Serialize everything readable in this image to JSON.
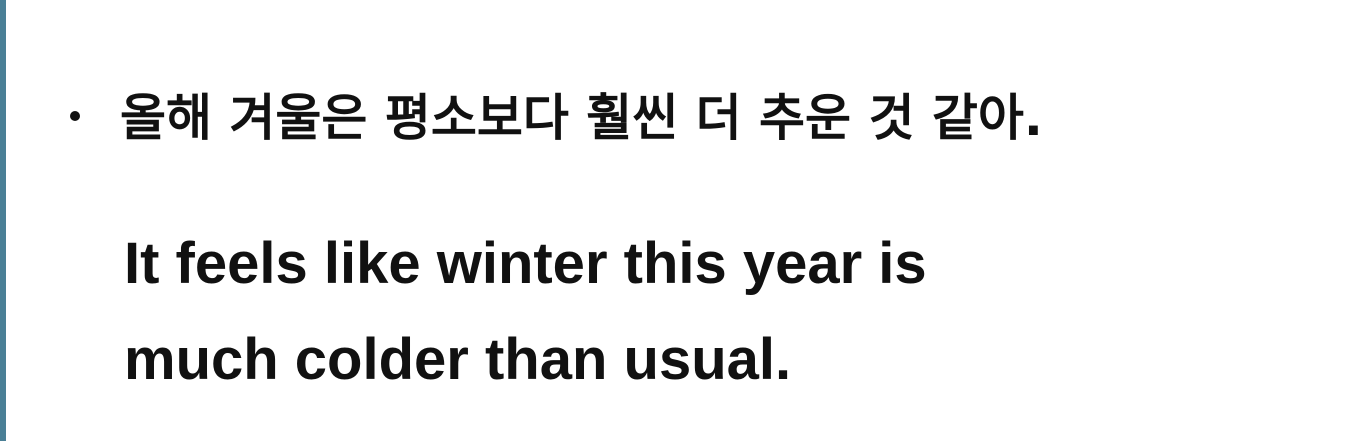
{
  "slide": {
    "korean_sentence": "올해 겨울은 평소보다 훨씬 더 추운 것 같아.",
    "english_lines": [
      "It feels like winter this year is",
      "much colder than usual."
    ],
    "colors": {
      "left_bar": "#4a7f96",
      "text": "#111111",
      "background": "#ffffff"
    }
  }
}
